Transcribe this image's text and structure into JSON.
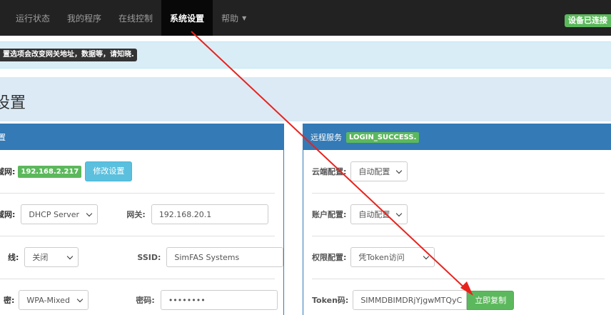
{
  "navbar": {
    "items": [
      {
        "label": "运行状态"
      },
      {
        "label": "我的程序"
      },
      {
        "label": "在线控制"
      },
      {
        "label": "系统设置"
      },
      {
        "label": "帮助"
      }
    ],
    "status_badge": "设备已连接"
  },
  "alert": {
    "text": "置选项会改变网关地址，数据等，请知晓."
  },
  "page_title": "设置",
  "left_panel": {
    "heading": "置",
    "lan_label": "域网:",
    "lan_ip": "192.168.2.217",
    "modify_button": "修改设置",
    "wan_label": "域网:",
    "wan_mode": "DHCP Server",
    "gateway_label": "网关:",
    "gateway_value": "192.168.20.1",
    "wireless_label": "线:",
    "wireless_value": "关闭",
    "ssid_label": "SSID:",
    "ssid_value": "SimFAS Systems",
    "encrypt_label": "密:",
    "encrypt_value": "WPA-Mixed",
    "password_label": "密码:",
    "password_value": "••••••••"
  },
  "right_panel": {
    "heading": "远程服务",
    "login_status": "LOGIN_SUCCESS.",
    "cloud_label": "云端配置:",
    "cloud_value": "自动配置",
    "account_label": "账户配置:",
    "account_value": "自动配置",
    "perm_label": "权限配置:",
    "perm_value": "凭Token访问",
    "token_label": "Token码:",
    "token_value": "SIMMDBIMDRjYjgwMTQyC",
    "copy_button": "立即复制"
  },
  "annotation": {
    "arrow_color": "#e8231e"
  }
}
